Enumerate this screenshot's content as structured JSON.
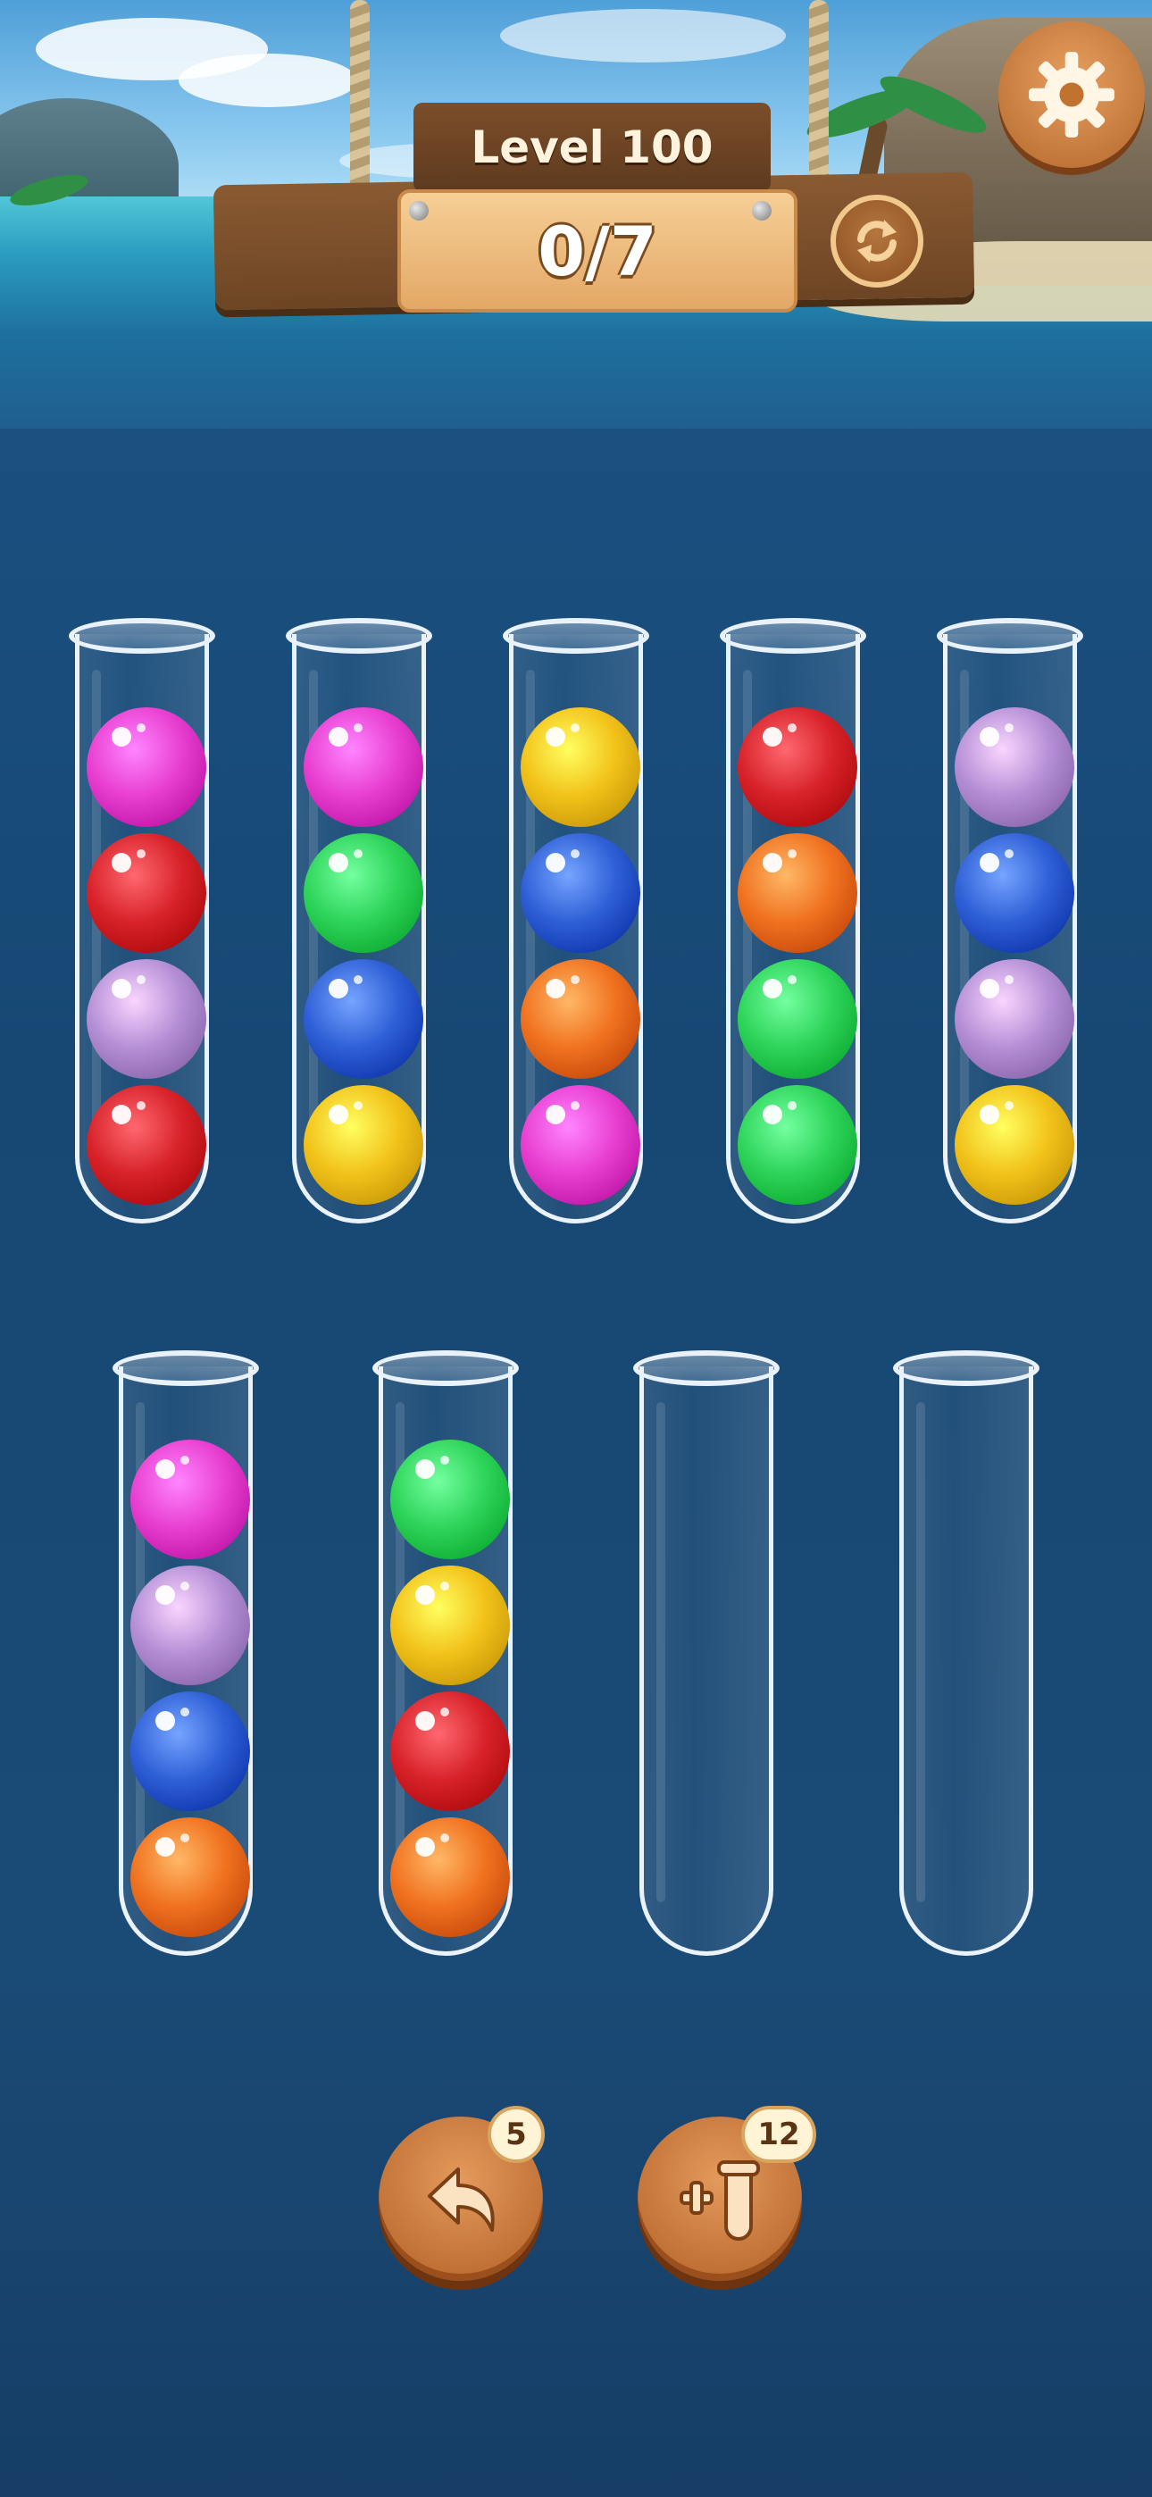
{
  "header": {
    "level_label": "Level 100",
    "progress_text": "0/7"
  },
  "colors": {
    "pink": "#e83fd0",
    "red": "#d8222a",
    "lavender": "#b48fd6",
    "green": "#2ed45a",
    "blue": "#2f5fd6",
    "yellow": "#f2c21a",
    "orange": "#f07220"
  },
  "tubes": [
    {
      "balls": [
        "pink",
        "red",
        "lavender",
        "red"
      ]
    },
    {
      "balls": [
        "pink",
        "green",
        "blue",
        "yellow"
      ]
    },
    {
      "balls": [
        "yellow",
        "blue",
        "orange",
        "pink"
      ]
    },
    {
      "balls": [
        "red",
        "orange",
        "green",
        "green"
      ]
    },
    {
      "balls": [
        "lavender",
        "blue",
        "lavender",
        "yellow"
      ]
    },
    {
      "balls": [
        "pink",
        "lavender",
        "blue",
        "orange"
      ]
    },
    {
      "balls": [
        "green",
        "yellow",
        "red",
        "orange"
      ]
    },
    {
      "balls": []
    },
    {
      "balls": []
    }
  ],
  "powerups": {
    "undo": {
      "icon": "undo-arrow-icon",
      "count": "5"
    },
    "add_tube": {
      "icon": "add-tube-icon",
      "count": "12"
    }
  },
  "icons": {
    "settings": "gear-icon",
    "restart": "restart-icon"
  }
}
